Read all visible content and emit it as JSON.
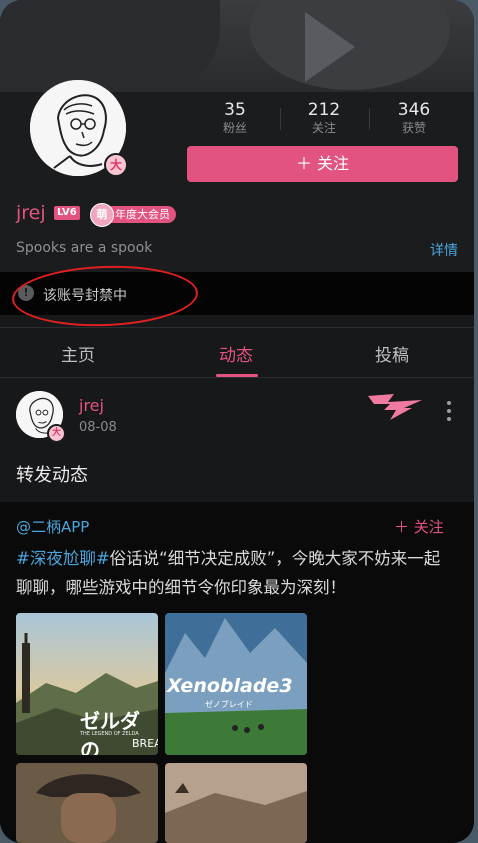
{
  "profile": {
    "username": "jrej",
    "level": "LV6",
    "vip_icon_text": "萌",
    "vip_tag": "年度大会员",
    "avatar_badge": "大",
    "signature": "Spooks are a spook",
    "detail_link": "详情",
    "stats": [
      {
        "value": "35",
        "label": "粉丝"
      },
      {
        "value": "212",
        "label": "关注"
      },
      {
        "value": "346",
        "label": "获赞"
      }
    ],
    "follow_button": "＋ 关注"
  },
  "banned": {
    "icon": "!",
    "text": "该账号封禁中"
  },
  "tabs": [
    {
      "label": "主页",
      "active": false
    },
    {
      "label": "动态",
      "active": true
    },
    {
      "label": "投稿",
      "active": false
    }
  ],
  "post": {
    "author": "jrej",
    "date": "08-08",
    "avatar_badge": "大",
    "text": "转发动态",
    "repost": {
      "source": "@二柄APP",
      "follow": "＋ 关注",
      "hashtag": "#深夜尬聊#",
      "body": "俗话说“细节决定成败”，今晚大家不妨来一起聊聊，哪些游戏中的细节令你印象最为深刻！",
      "images": [
        {
          "caption": "ゼルダの",
          "sub": "THE LEGEND OF ZELDA",
          "sub2": "BREA"
        },
        {
          "caption": "Xenoblade3",
          "sub": "ゼノブレイド"
        },
        {
          "caption": ""
        },
        {
          "caption": ""
        }
      ]
    }
  },
  "colors": {
    "accent": "#e25380",
    "link": "#4aa6de",
    "background": "#17181a"
  }
}
